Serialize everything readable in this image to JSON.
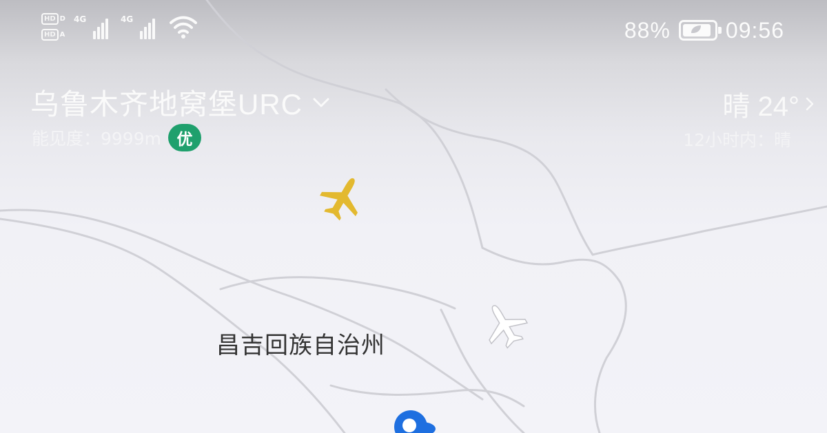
{
  "status_bar": {
    "hd_labels": [
      "HD",
      "HD"
    ],
    "network_1": "4G",
    "network_2": "4G",
    "battery_percent": "88%",
    "time": "09:56"
  },
  "header": {
    "airport_name": "乌鲁木齐地窝堡URC",
    "visibility": "能见度：9999m",
    "air_quality": "优",
    "weather_now": "晴 24°",
    "forecast": "12小时内：晴"
  },
  "map": {
    "region_label": "昌吉回族自治州",
    "colors": {
      "selected_plane": "#e3b92f",
      "other_plane": "#ffffff",
      "location_marker": "#1e6fe0",
      "aqi_good": "#1fa06d"
    }
  }
}
